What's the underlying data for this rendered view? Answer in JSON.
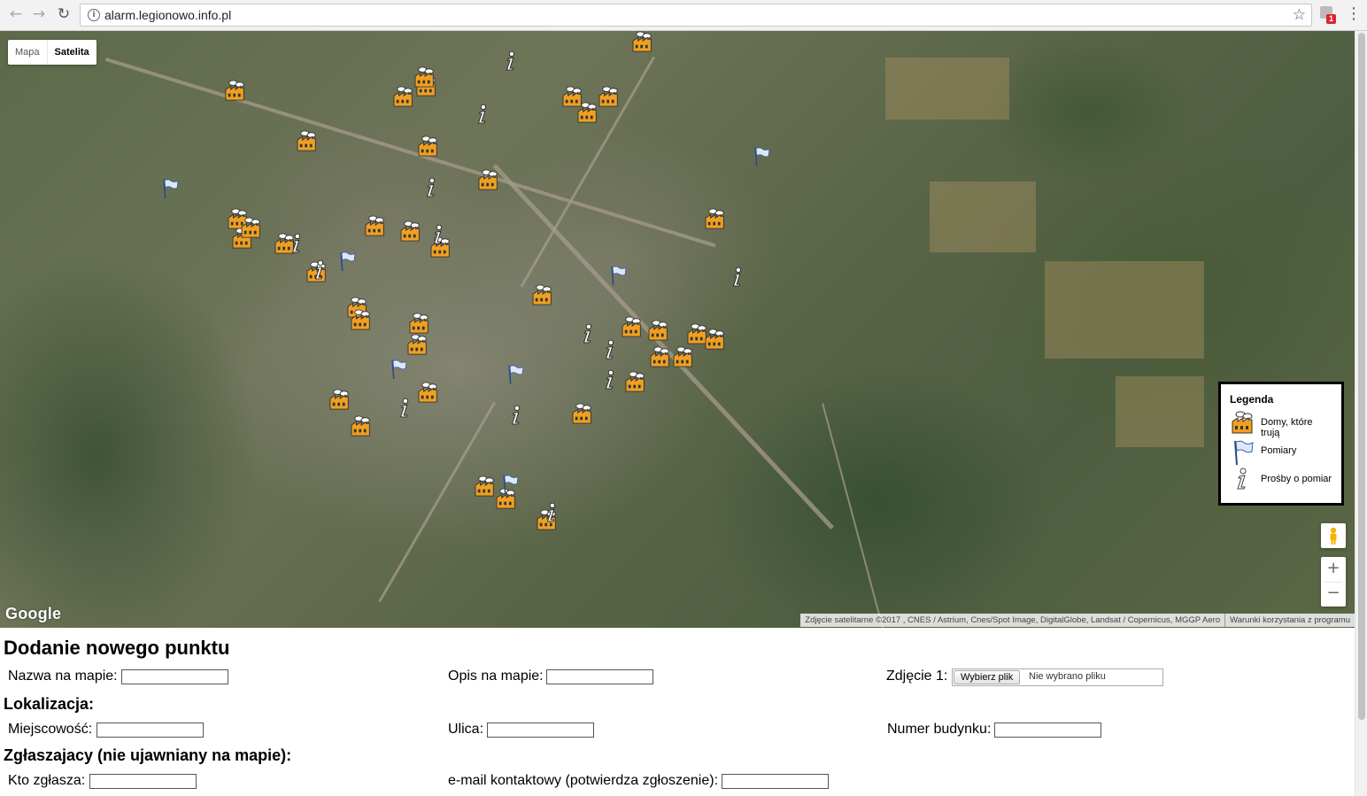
{
  "browser": {
    "url": "alarm.legionowo.info.pl",
    "back_icon": "arrow-left-icon",
    "forward_icon": "arrow-right-icon",
    "reload_icon": "reload-icon",
    "extension_badge": "1"
  },
  "map": {
    "type_control": {
      "map_label": "Mapa",
      "satellite_label": "Satelita",
      "selected": "Satelita"
    },
    "google_logo": "Google",
    "attribution": "Zdjęcie satelitarne ©2017 , CNES / Astrium, Cnes/Spot Image, DigitalGlobe, Landsat / Copernicus, MGGP Aero",
    "terms": "Warunki korzystania z programu",
    "zoom_in": "+",
    "zoom_out": "−",
    "legend": {
      "title": "Legenda",
      "items": [
        {
          "icon": "factory-icon",
          "label": "Domy, które trują"
        },
        {
          "icon": "flag-icon",
          "label": "Pomiary"
        },
        {
          "icon": "info-icon",
          "label": "Prośby o pomiar"
        }
      ]
    },
    "colors": {
      "factory": "#f0a020",
      "flag": "#6699dd",
      "legend_border": "#000000"
    }
  },
  "form": {
    "title": "Dodanie nowego punktu",
    "fields": {
      "name_label": "Nazwa na mapie:",
      "desc_label": "Opis na mapie:",
      "photo_label": "Zdjęcie 1:",
      "file_button": "Wybierz plik",
      "file_status": "Nie wybrano pliku"
    },
    "location": {
      "heading": "Lokalizacja:",
      "city_label": "Miejscowość:",
      "street_label": "Ulica:",
      "building_label": "Numer budynku:"
    },
    "reporter": {
      "heading": "Zgłaszajacy (nie ujawniany na mapie):",
      "who_label": "Kto zgłasza:",
      "email_label": "e-mail kontaktowy (potwierdza zgłoszenie):"
    }
  }
}
